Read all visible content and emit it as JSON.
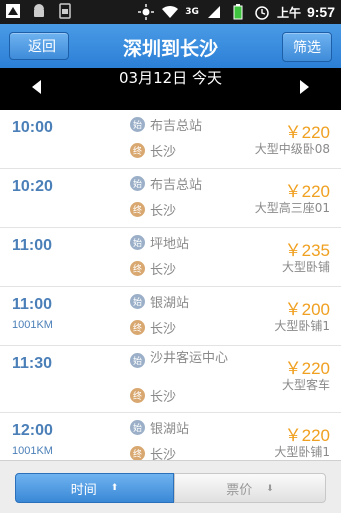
{
  "statusbar": {
    "time": "9:57",
    "ampm": "上午",
    "network": "3G"
  },
  "header": {
    "back_label": "返回",
    "title": "深圳到长沙",
    "filter_label": "筛选"
  },
  "datebar": {
    "date": "03月12日 今天"
  },
  "badges": {
    "start": "始",
    "end": "终"
  },
  "trips": [
    {
      "time": "10:00",
      "km": "",
      "from": "布吉总站",
      "to": "长沙",
      "price": "￥220",
      "coach": "大型中级卧08"
    },
    {
      "time": "10:20",
      "km": "",
      "from": "布吉总站",
      "to": "长沙",
      "price": "￥220",
      "coach": "大型高三座01"
    },
    {
      "time": "11:00",
      "km": "",
      "from": "坪地站",
      "to": "长沙",
      "price": "￥235",
      "coach": "大型卧铺"
    },
    {
      "time": "11:00",
      "km": "1001KM",
      "from": "银湖站",
      "to": "长沙",
      "price": "￥200",
      "coach": "大型卧铺1"
    },
    {
      "time": "11:30",
      "km": "",
      "from": "沙井客运中心",
      "to": "长沙",
      "price": "￥220",
      "coach": "大型客车"
    },
    {
      "time": "12:00",
      "km": "1001KM",
      "from": "银湖站",
      "to": "长沙",
      "price": "￥220",
      "coach": "大型卧铺1"
    }
  ],
  "sort": {
    "time_label": "时间",
    "price_label": "票价",
    "up_arrow": "⬆",
    "down_arrow": "⬇"
  },
  "colors": {
    "titlebar": "#2b7fd6",
    "price": "#f0a020",
    "time": "#4b7fb8"
  }
}
